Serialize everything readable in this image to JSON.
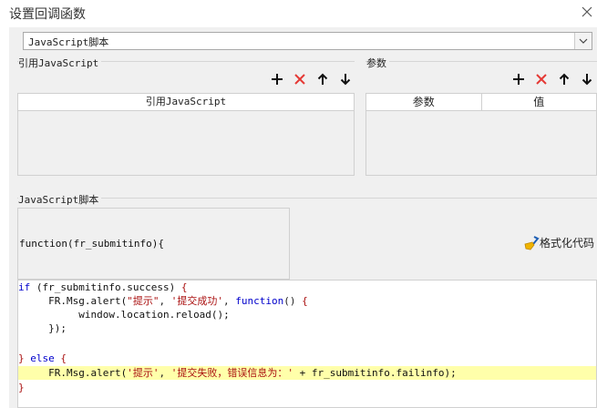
{
  "window": {
    "title": "设置回调函数"
  },
  "script_type": {
    "selected": "JavaScript脚本"
  },
  "ref_section": {
    "label": "引用JavaScript",
    "column": "引用JavaScript"
  },
  "params_section": {
    "label": "参数",
    "columns": [
      "参数",
      "值"
    ]
  },
  "script_section": {
    "label": "JavaScript脚本",
    "function_header": "function(fr_submitinfo){",
    "format_button": "格式化代码"
  },
  "code": {
    "l1": {
      "kw1": "if",
      "p1": " (fr_submitinfo.success) ",
      "b1": "{"
    },
    "l2": {
      "indent": "     ",
      "fn": "FR.Msg.alert(",
      "s1": "\"提示\"",
      "c1": ", ",
      "s2": "'提交成功'",
      "c2": ", ",
      "kw": "function",
      "p": "() ",
      "b": "{"
    },
    "l3": {
      "indent": "          ",
      "text": "window.location.reload();"
    },
    "l4": {
      "indent": "     ",
      "text": "});"
    },
    "l5": {
      "b1": "}",
      "kw": " else ",
      "b2": "{"
    },
    "l6": {
      "indent": "     ",
      "fn": "FR.Msg.alert(",
      "s1": "'提示'",
      "c1": ", ",
      "s2": "'提交失败，错误信息为：'",
      "rest": " + fr_submitinfo.failinfo);"
    },
    "l7": {
      "b": "}"
    }
  },
  "colors": {
    "keyword": "#0000cc",
    "string": "#aa1111",
    "highlight": "#ffffaa",
    "delete_icon": "#e53935"
  },
  "icons": [
    "close-icon",
    "add-icon",
    "delete-icon",
    "arrow-up-icon",
    "arrow-down-icon",
    "dropdown-chevron-icon",
    "broom-icon"
  ]
}
